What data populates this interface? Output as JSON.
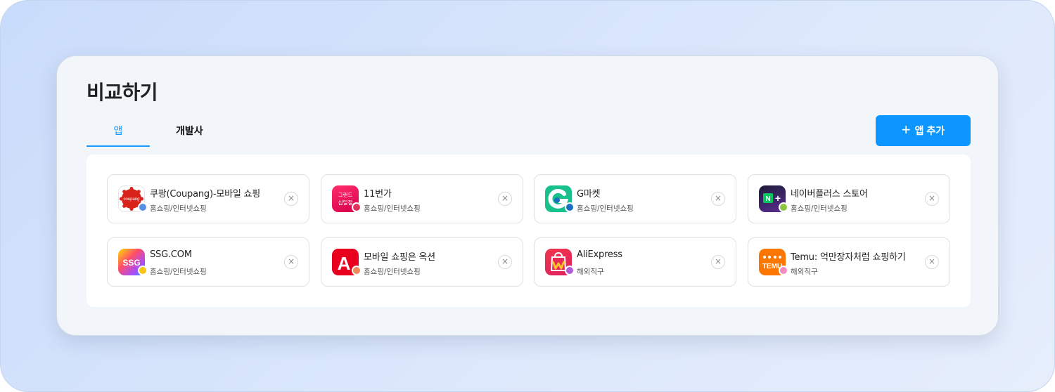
{
  "page": {
    "title": "비교하기"
  },
  "tabs": [
    {
      "label": "앱"
    },
    {
      "label": "개발사"
    }
  ],
  "add_button": {
    "label": "앱 추가",
    "icon": "plus-icon"
  },
  "apps": [
    {
      "name": "쿠팡(Coupang)-모바일 쇼핑",
      "category": "홈쇼핑/인터넷쇼핑",
      "dot_color": "#5b8fe6",
      "icon_text": "coupang",
      "brand_color": "#e1251b"
    },
    {
      "name": "11번가",
      "category": "홈쇼핑/인터넷쇼핑",
      "dot_color": "#e0335b",
      "icon_text": "그랜드 십일절",
      "brand_color": "#ff1e5a"
    },
    {
      "name": "G마켓",
      "category": "홈쇼핑/인터넷쇼핑",
      "dot_color": "#1b6fc2",
      "icon_text": "G",
      "brand_color": "#18c08c"
    },
    {
      "name": "네이버플러스 스토어",
      "category": "홈쇼핑/인터넷쇼핑",
      "dot_color": "#8cc63f",
      "icon_text": "N+",
      "brand_color": "#5b2d90"
    },
    {
      "name": "SSG.COM",
      "category": "홈쇼핑/인터넷쇼핑",
      "dot_color": "#f5c518",
      "icon_text": "SSG",
      "brand_color": "#ff4d6a"
    },
    {
      "name": "모바일 쇼핑은 옥션",
      "category": "홈쇼핑/인터넷쇼핑",
      "dot_color": "#f08a5d",
      "icon_text": "A",
      "brand_color": "#e8001e"
    },
    {
      "name": "AliExpress",
      "category": "해외직구",
      "dot_color": "#b45cd6",
      "icon_text": "M",
      "brand_color": "#ee3b3b"
    },
    {
      "name": "Temu: 억만장자처럼 쇼핑하기",
      "category": "해외직구",
      "dot_color": "#f58cc0",
      "icon_text": "TEMU",
      "brand_color": "#fb7701"
    }
  ],
  "remove_label": "×"
}
